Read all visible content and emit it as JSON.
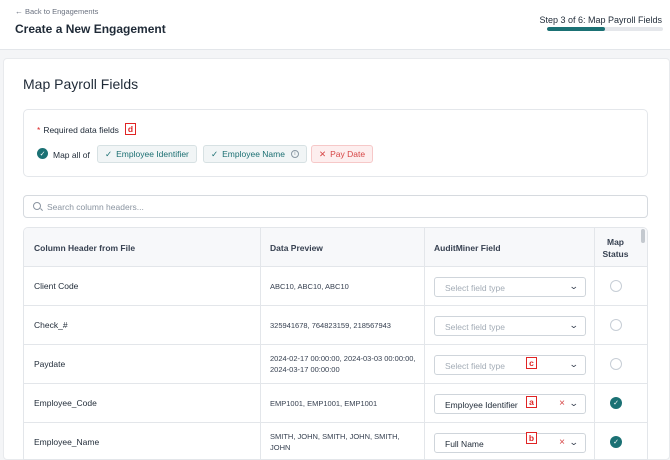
{
  "header": {
    "back_label": "Back to Engagements",
    "title": "Create a New Engagement",
    "step_label": "Step 3 of 6: Map Payroll Fields",
    "progress_fraction": 0.5
  },
  "section_title": "Map Payroll Fields",
  "required": {
    "label": "Required data fields",
    "map_all_label": "Map all of",
    "chips": [
      {
        "label": "Employee Identifier",
        "status": "mapped"
      },
      {
        "label": "Employee Name",
        "status": "mapped"
      },
      {
        "label": "Pay Date",
        "status": "missing"
      }
    ]
  },
  "search": {
    "placeholder": "Search column headers..."
  },
  "table": {
    "headers": {
      "column_header": "Column Header from File",
      "data_preview": "Data Preview",
      "field": "AuditMiner Field",
      "status_line1": "Map",
      "status_line2": "Status"
    },
    "select_placeholder": "Select field type",
    "rows": [
      {
        "name": "Client Code",
        "preview": "ABC10, ABC10, ABC10",
        "field": "",
        "mapped": false
      },
      {
        "name": "Check_#",
        "preview": "325941678, 764823159, 218567943",
        "field": "",
        "mapped": false
      },
      {
        "name": "Paydate",
        "preview": "2024-02-17 00:00:00, 2024-03-03 00:00:00, 2024-03-17 00:00:00",
        "field": "",
        "mapped": false
      },
      {
        "name": "Employee_Code",
        "preview": "EMP1001, EMP1001, EMP1001",
        "field": "Employee Identifier",
        "mapped": true
      },
      {
        "name": "Employee_Name",
        "preview": "SMITH, JOHN, SMITH, JOHN, SMITH, JOHN",
        "field": "Full Name",
        "mapped": true
      }
    ]
  },
  "markers": {
    "a": "a",
    "b": "b",
    "c": "c",
    "d": "d"
  },
  "colors": {
    "accent": "#1b7174",
    "error": "#d64545",
    "marker": "#e02424"
  }
}
